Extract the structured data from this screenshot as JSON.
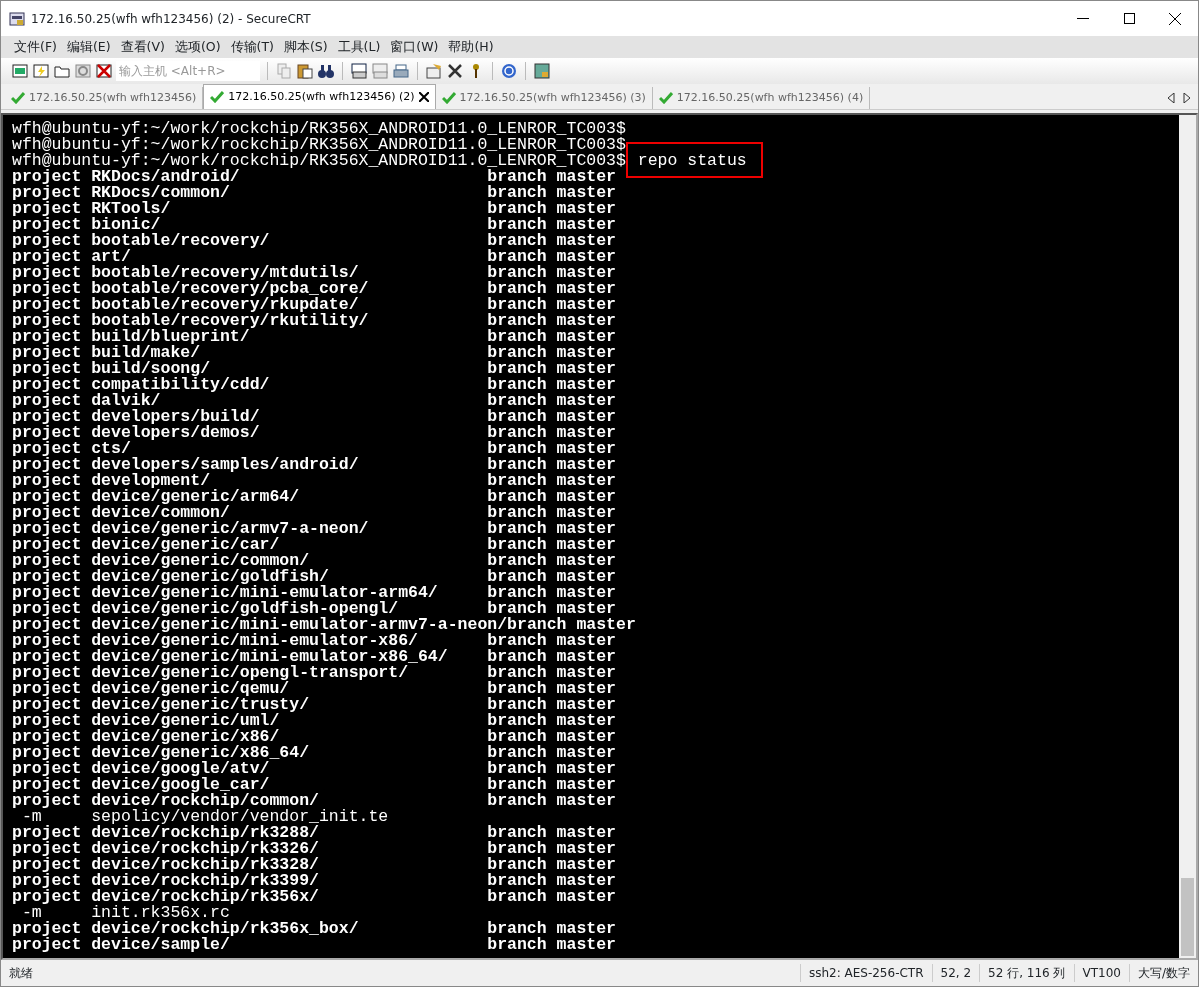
{
  "window": {
    "title": "172.16.50.25(wfh wfh123456) (2) - SecureCRT"
  },
  "menu": [
    "文件(F)",
    "编辑(E)",
    "查看(V)",
    "选项(O)",
    "传输(T)",
    "脚本(S)",
    "工具(L)",
    "窗口(W)",
    "帮助(H)"
  ],
  "toolbar": {
    "host_field": {
      "placeholder": "输入主机 <Alt+R>"
    }
  },
  "tabs": [
    {
      "label": "172.16.50.25(wfh wfh123456)",
      "selected": false,
      "closable": false
    },
    {
      "label": "172.16.50.25(wfh wfh123456) (2)",
      "selected": true,
      "closable": true
    },
    {
      "label": "172.16.50.25(wfh wfh123456) (3)",
      "selected": false,
      "closable": false
    },
    {
      "label": "172.16.50.25(wfh wfh123456) (4)",
      "selected": false,
      "closable": false
    }
  ],
  "terminal": {
    "lines": [
      {
        "kind": "prompt",
        "text": "wfh@ubuntu-yf:~/work/rockchip/RK356X_ANDROID11.0_LENROR_TC003$"
      },
      {
        "kind": "prompt",
        "text": "wfh@ubuntu-yf:~/work/rockchip/RK356X_ANDROID11.0_LENROR_TC003$"
      },
      {
        "kind": "prompt",
        "text": "wfh@ubuntu-yf:~/work/rockchip/RK356X_ANDROID11.0_LENROR_TC003$",
        "command": "repo status",
        "highlighted": true
      },
      {
        "kind": "project",
        "text": "project RKDocs/android/",
        "status": "branch master"
      },
      {
        "kind": "project",
        "text": "project RKDocs/common/",
        "status": "branch master"
      },
      {
        "kind": "project",
        "text": "project RKTools/",
        "status": "branch master"
      },
      {
        "kind": "project",
        "text": "project bionic/",
        "status": "branch master"
      },
      {
        "kind": "project",
        "text": "project bootable/recovery/",
        "status": "branch master"
      },
      {
        "kind": "project",
        "text": "project art/",
        "status": "branch master"
      },
      {
        "kind": "project",
        "text": "project bootable/recovery/mtdutils/",
        "status": "branch master"
      },
      {
        "kind": "project",
        "text": "project bootable/recovery/pcba_core/",
        "status": "branch master"
      },
      {
        "kind": "project",
        "text": "project bootable/recovery/rkupdate/",
        "status": "branch master"
      },
      {
        "kind": "project",
        "text": "project bootable/recovery/rkutility/",
        "status": "branch master"
      },
      {
        "kind": "project",
        "text": "project build/blueprint/",
        "status": "branch master"
      },
      {
        "kind": "project",
        "text": "project build/make/",
        "status": "branch master"
      },
      {
        "kind": "project",
        "text": "project build/soong/",
        "status": "branch master"
      },
      {
        "kind": "project",
        "text": "project compatibility/cdd/",
        "status": "branch master"
      },
      {
        "kind": "project",
        "text": "project dalvik/",
        "status": "branch master"
      },
      {
        "kind": "project",
        "text": "project developers/build/",
        "status": "branch master"
      },
      {
        "kind": "project",
        "text": "project developers/demos/",
        "status": "branch master"
      },
      {
        "kind": "project",
        "text": "project cts/",
        "status": "branch master"
      },
      {
        "kind": "project",
        "text": "project developers/samples/android/",
        "status": "branch master"
      },
      {
        "kind": "project",
        "text": "project development/",
        "status": "branch master"
      },
      {
        "kind": "project",
        "text": "project device/generic/arm64/",
        "status": "branch master"
      },
      {
        "kind": "project",
        "text": "project device/common/",
        "status": "branch master"
      },
      {
        "kind": "project",
        "text": "project device/generic/armv7-a-neon/",
        "status": "branch master"
      },
      {
        "kind": "project",
        "text": "project device/generic/car/",
        "status": "branch master"
      },
      {
        "kind": "project",
        "text": "project device/generic/common/",
        "status": "branch master"
      },
      {
        "kind": "project",
        "text": "project device/generic/goldfish/",
        "status": "branch master"
      },
      {
        "kind": "project",
        "text": "project device/generic/mini-emulator-arm64/",
        "status": "branch master"
      },
      {
        "kind": "project",
        "text": "project device/generic/goldfish-opengl/",
        "status": "branch master"
      },
      {
        "kind": "project",
        "text": "project device/generic/mini-emulator-armv7-a-neon/",
        "status": "branch master"
      },
      {
        "kind": "project",
        "text": "project device/generic/mini-emulator-x86/",
        "status": "branch master"
      },
      {
        "kind": "project",
        "text": "project device/generic/mini-emulator-x86_64/",
        "status": "branch master"
      },
      {
        "kind": "project",
        "text": "project device/generic/opengl-transport/",
        "status": "branch master"
      },
      {
        "kind": "project",
        "text": "project device/generic/qemu/",
        "status": "branch master"
      },
      {
        "kind": "project",
        "text": "project device/generic/trusty/",
        "status": "branch master"
      },
      {
        "kind": "project",
        "text": "project device/generic/uml/",
        "status": "branch master"
      },
      {
        "kind": "project",
        "text": "project device/generic/x86/",
        "status": "branch master"
      },
      {
        "kind": "project",
        "text": "project device/generic/x86_64/",
        "status": "branch master"
      },
      {
        "kind": "project",
        "text": "project device/google/atv/",
        "status": "branch master"
      },
      {
        "kind": "project",
        "text": "project device/google_car/",
        "status": "branch master"
      },
      {
        "kind": "project",
        "text": "project device/rockchip/common/",
        "status": "branch master"
      },
      {
        "kind": "file",
        "flag": "-m",
        "text": "sepolicy/vendor/vendor_init.te"
      },
      {
        "kind": "project",
        "text": "project device/rockchip/rk3288/",
        "status": "branch master"
      },
      {
        "kind": "project",
        "text": "project device/rockchip/rk3326/",
        "status": "branch master"
      },
      {
        "kind": "project",
        "text": "project device/rockchip/rk3328/",
        "status": "branch master"
      },
      {
        "kind": "project",
        "text": "project device/rockchip/rk3399/",
        "status": "branch master"
      },
      {
        "kind": "project",
        "text": "project device/rockchip/rk356x/",
        "status": "branch master"
      },
      {
        "kind": "file",
        "flag": "-m",
        "text": "init.rk356x.rc"
      },
      {
        "kind": "project",
        "text": "project device/rockchip/rk356x_box/",
        "status": "branch master"
      },
      {
        "kind": "project",
        "text": "project device/sample/",
        "status": "branch master"
      }
    ]
  },
  "status_bar": [
    "就绪",
    "ssh2: AES-256-CTR",
    "52,  2",
    "52 行, 116 列",
    "VT100",
    "大写/数字"
  ]
}
